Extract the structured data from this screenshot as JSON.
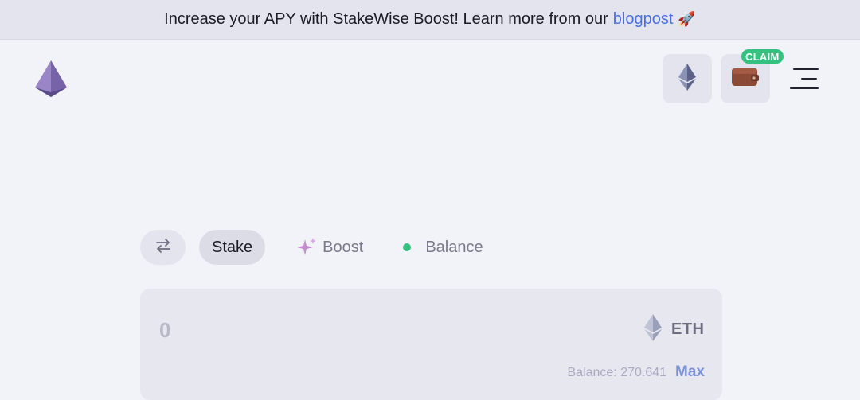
{
  "banner": {
    "text": "Increase your APY with StakeWise Boost! Learn more from our",
    "link": "blogpost",
    "emoji": "🚀"
  },
  "header": {
    "logo": "stakewise-logo",
    "network_icon": "ethereum-icon",
    "wallet_icon": "wallet-icon",
    "claim_badge": "CLAIM",
    "menu_icon": "hamburger-menu-icon"
  },
  "tabs": {
    "swap_icon": "swap-arrows-icon",
    "stake": "Stake",
    "boost": "Boost",
    "balance": "Balance"
  },
  "stake_form": {
    "amount_placeholder": "0",
    "token": "ETH",
    "balance_text": "Balance: 270.641",
    "max_label": "Max"
  },
  "colors": {
    "accent_link": "#4a6fe0",
    "claim_green": "#35c281",
    "max_blue": "#7b92d8",
    "background": "#f2f2f9"
  }
}
